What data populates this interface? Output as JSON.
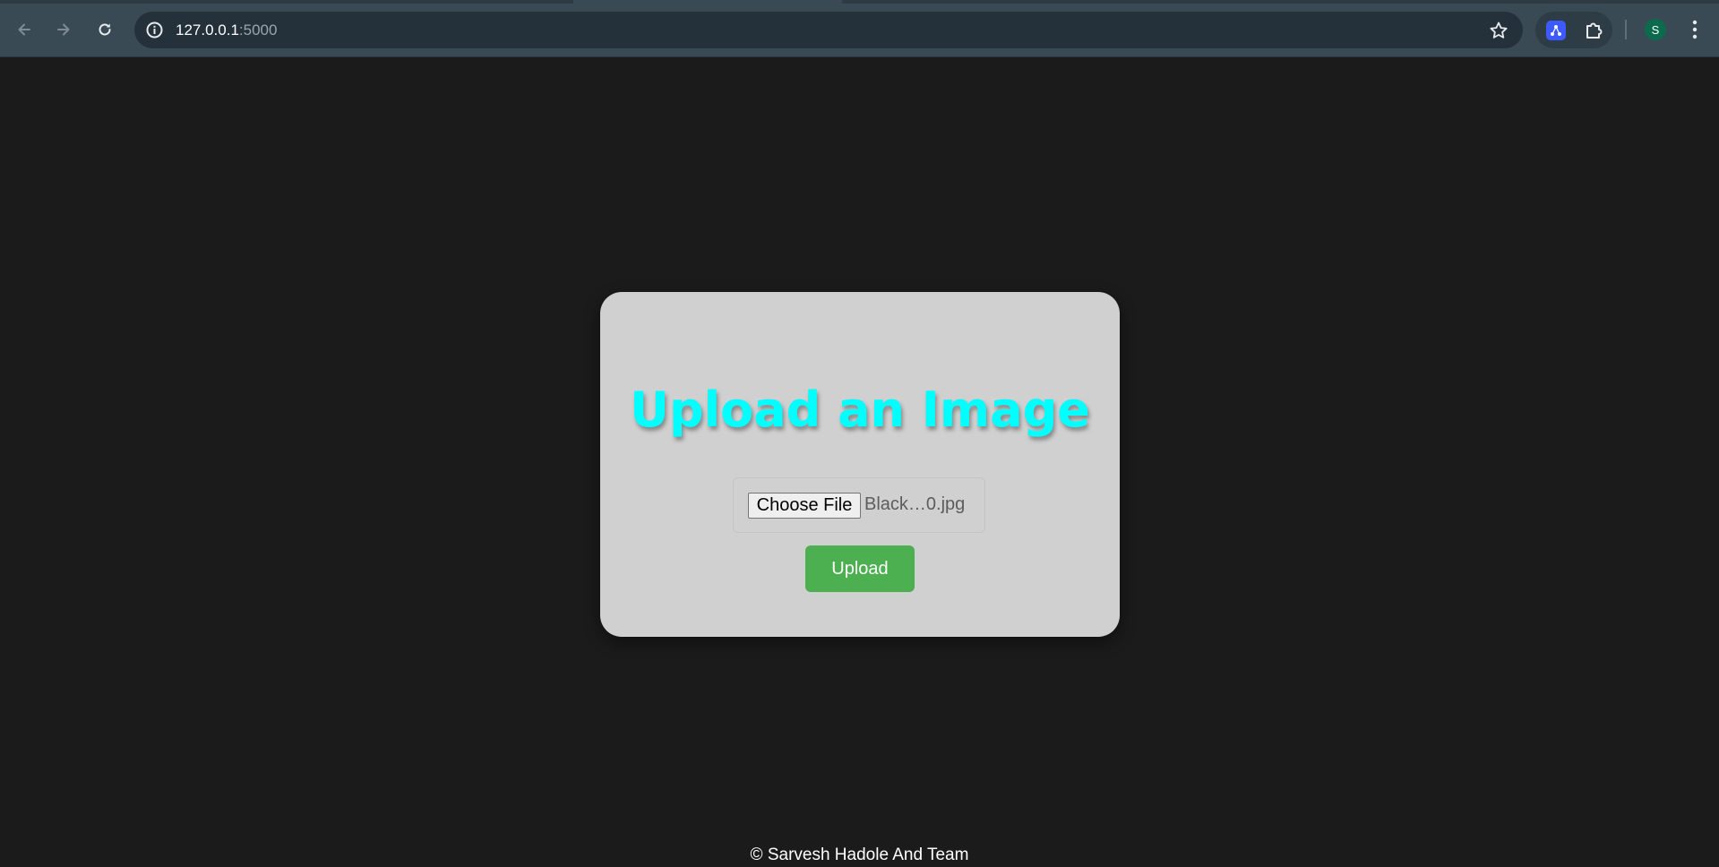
{
  "browser": {
    "url_host": "127.0.0.1",
    "url_port": ":5000",
    "profile_initial": "S",
    "icons": {
      "back": "arrow-left-icon",
      "forward": "arrow-right-icon",
      "reload": "reload-icon",
      "site_info": "info-icon",
      "bookmark": "star-icon",
      "extension_app": "extension-app-icon",
      "extensions": "puzzle-icon",
      "menu": "kebab-menu-icon"
    }
  },
  "page": {
    "title": "Upload an Image",
    "choose_file_label": "Choose File",
    "file_name": "Black…0.jpg",
    "upload_label": "Upload",
    "footer": "© Sarvesh Hadole And Team"
  },
  "colors": {
    "page_background": "#1b1b1b",
    "card_background": "#d0d0d0",
    "title_color": "#00ffff",
    "upload_button": "#4caf50",
    "avatar": "#0c6b4d"
  }
}
